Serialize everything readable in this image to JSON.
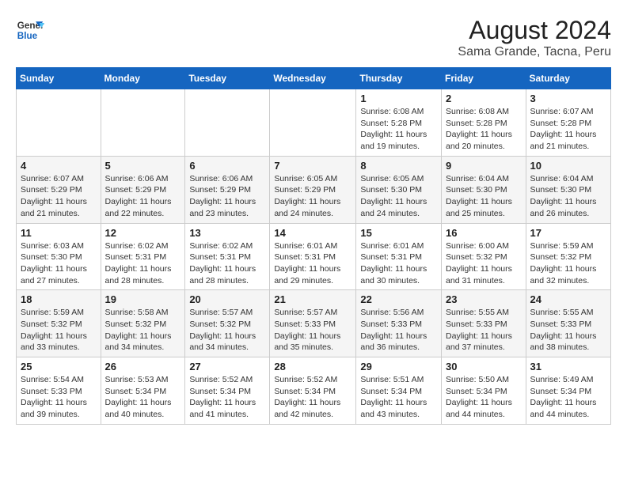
{
  "header": {
    "logo_general": "General",
    "logo_blue": "Blue",
    "title": "August 2024",
    "subtitle": "Sama Grande, Tacna, Peru"
  },
  "weekdays": [
    "Sunday",
    "Monday",
    "Tuesday",
    "Wednesday",
    "Thursday",
    "Friday",
    "Saturday"
  ],
  "weeks": [
    [
      {
        "day": "",
        "info": ""
      },
      {
        "day": "",
        "info": ""
      },
      {
        "day": "",
        "info": ""
      },
      {
        "day": "",
        "info": ""
      },
      {
        "day": "1",
        "info": "Sunrise: 6:08 AM\nSunset: 5:28 PM\nDaylight: 11 hours\nand 19 minutes."
      },
      {
        "day": "2",
        "info": "Sunrise: 6:08 AM\nSunset: 5:28 PM\nDaylight: 11 hours\nand 20 minutes."
      },
      {
        "day": "3",
        "info": "Sunrise: 6:07 AM\nSunset: 5:28 PM\nDaylight: 11 hours\nand 21 minutes."
      }
    ],
    [
      {
        "day": "4",
        "info": "Sunrise: 6:07 AM\nSunset: 5:29 PM\nDaylight: 11 hours\nand 21 minutes."
      },
      {
        "day": "5",
        "info": "Sunrise: 6:06 AM\nSunset: 5:29 PM\nDaylight: 11 hours\nand 22 minutes."
      },
      {
        "day": "6",
        "info": "Sunrise: 6:06 AM\nSunset: 5:29 PM\nDaylight: 11 hours\nand 23 minutes."
      },
      {
        "day": "7",
        "info": "Sunrise: 6:05 AM\nSunset: 5:29 PM\nDaylight: 11 hours\nand 24 minutes."
      },
      {
        "day": "8",
        "info": "Sunrise: 6:05 AM\nSunset: 5:30 PM\nDaylight: 11 hours\nand 24 minutes."
      },
      {
        "day": "9",
        "info": "Sunrise: 6:04 AM\nSunset: 5:30 PM\nDaylight: 11 hours\nand 25 minutes."
      },
      {
        "day": "10",
        "info": "Sunrise: 6:04 AM\nSunset: 5:30 PM\nDaylight: 11 hours\nand 26 minutes."
      }
    ],
    [
      {
        "day": "11",
        "info": "Sunrise: 6:03 AM\nSunset: 5:30 PM\nDaylight: 11 hours\nand 27 minutes."
      },
      {
        "day": "12",
        "info": "Sunrise: 6:02 AM\nSunset: 5:31 PM\nDaylight: 11 hours\nand 28 minutes."
      },
      {
        "day": "13",
        "info": "Sunrise: 6:02 AM\nSunset: 5:31 PM\nDaylight: 11 hours\nand 28 minutes."
      },
      {
        "day": "14",
        "info": "Sunrise: 6:01 AM\nSunset: 5:31 PM\nDaylight: 11 hours\nand 29 minutes."
      },
      {
        "day": "15",
        "info": "Sunrise: 6:01 AM\nSunset: 5:31 PM\nDaylight: 11 hours\nand 30 minutes."
      },
      {
        "day": "16",
        "info": "Sunrise: 6:00 AM\nSunset: 5:32 PM\nDaylight: 11 hours\nand 31 minutes."
      },
      {
        "day": "17",
        "info": "Sunrise: 5:59 AM\nSunset: 5:32 PM\nDaylight: 11 hours\nand 32 minutes."
      }
    ],
    [
      {
        "day": "18",
        "info": "Sunrise: 5:59 AM\nSunset: 5:32 PM\nDaylight: 11 hours\nand 33 minutes."
      },
      {
        "day": "19",
        "info": "Sunrise: 5:58 AM\nSunset: 5:32 PM\nDaylight: 11 hours\nand 34 minutes."
      },
      {
        "day": "20",
        "info": "Sunrise: 5:57 AM\nSunset: 5:32 PM\nDaylight: 11 hours\nand 34 minutes."
      },
      {
        "day": "21",
        "info": "Sunrise: 5:57 AM\nSunset: 5:33 PM\nDaylight: 11 hours\nand 35 minutes."
      },
      {
        "day": "22",
        "info": "Sunrise: 5:56 AM\nSunset: 5:33 PM\nDaylight: 11 hours\nand 36 minutes."
      },
      {
        "day": "23",
        "info": "Sunrise: 5:55 AM\nSunset: 5:33 PM\nDaylight: 11 hours\nand 37 minutes."
      },
      {
        "day": "24",
        "info": "Sunrise: 5:55 AM\nSunset: 5:33 PM\nDaylight: 11 hours\nand 38 minutes."
      }
    ],
    [
      {
        "day": "25",
        "info": "Sunrise: 5:54 AM\nSunset: 5:33 PM\nDaylight: 11 hours\nand 39 minutes."
      },
      {
        "day": "26",
        "info": "Sunrise: 5:53 AM\nSunset: 5:34 PM\nDaylight: 11 hours\nand 40 minutes."
      },
      {
        "day": "27",
        "info": "Sunrise: 5:52 AM\nSunset: 5:34 PM\nDaylight: 11 hours\nand 41 minutes."
      },
      {
        "day": "28",
        "info": "Sunrise: 5:52 AM\nSunset: 5:34 PM\nDaylight: 11 hours\nand 42 minutes."
      },
      {
        "day": "29",
        "info": "Sunrise: 5:51 AM\nSunset: 5:34 PM\nDaylight: 11 hours\nand 43 minutes."
      },
      {
        "day": "30",
        "info": "Sunrise: 5:50 AM\nSunset: 5:34 PM\nDaylight: 11 hours\nand 44 minutes."
      },
      {
        "day": "31",
        "info": "Sunrise: 5:49 AM\nSunset: 5:34 PM\nDaylight: 11 hours\nand 44 minutes."
      }
    ]
  ]
}
